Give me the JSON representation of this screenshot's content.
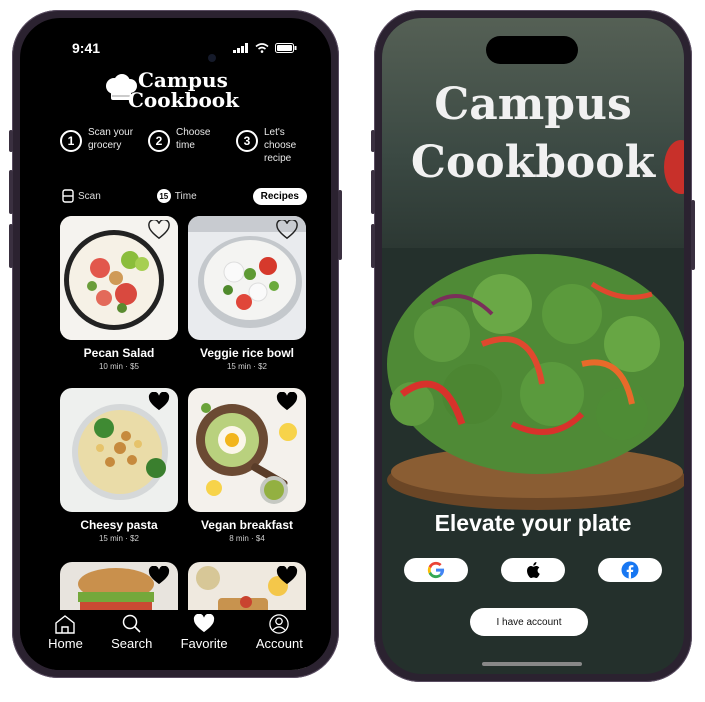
{
  "left_phone": {
    "status_time": "9:41",
    "logo_line1": "Campus",
    "logo_line2": "Cookbook",
    "steps": [
      {
        "num": "1",
        "text": "Scan your grocery"
      },
      {
        "num": "2",
        "text": "Choose time"
      },
      {
        "num": "3",
        "text": "Let's choose recipe"
      }
    ],
    "tabs": {
      "scan": "Scan",
      "time_badge": "15",
      "time": "Time",
      "recipes": "Recipes"
    },
    "recipes": [
      {
        "name": "Pecan Salad",
        "meta": "10 min · $5",
        "favorited": false
      },
      {
        "name": "Veggie rice bowl",
        "meta": "15 min · $2",
        "favorited": false
      },
      {
        "name": "Cheesy pasta",
        "meta": "15 min · $2",
        "favorited": true
      },
      {
        "name": "Vegan breakfast",
        "meta": "8 min · $4",
        "favorited": true
      }
    ],
    "nav": {
      "home": "Home",
      "search": "Search",
      "favorite": "Favorite",
      "account": "Account"
    }
  },
  "right_phone": {
    "logo_line1": "Campus",
    "logo_line2": "Cookbook",
    "tagline": "Elevate your plate",
    "account_button": "I have account"
  },
  "colors": {
    "google_blue": "#4285F4",
    "google_red": "#EA4335",
    "google_yellow": "#FBBC05",
    "google_green": "#34A853",
    "facebook_blue": "#1877F2",
    "tomato": "#c8302a"
  }
}
